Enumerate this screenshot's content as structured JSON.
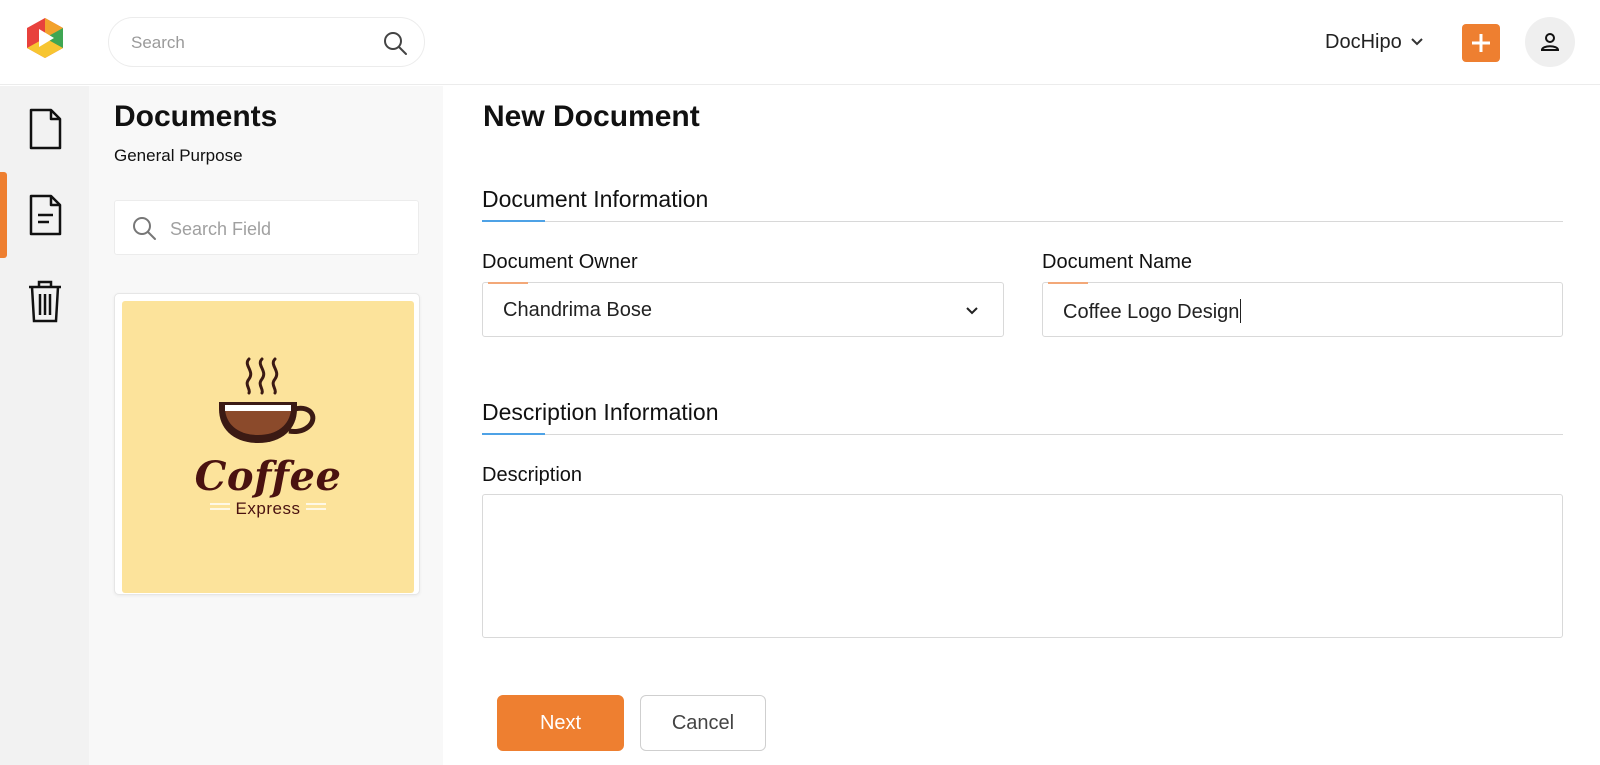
{
  "app": {
    "logo_icon": "dochipo-logo-icon"
  },
  "header": {
    "search": {
      "placeholder": "Search",
      "icon": "search-icon"
    },
    "account": {
      "name": "DocHipo",
      "icon": "chevron-down-icon"
    },
    "add_button": {
      "icon": "plus-icon",
      "color": "#ee7f30"
    },
    "avatar": {
      "icon": "user-icon"
    }
  },
  "rail": {
    "items": [
      {
        "name": "documents",
        "icon": "document-icon",
        "active": false
      },
      {
        "name": "templates",
        "icon": "document-lines-icon",
        "active": true
      },
      {
        "name": "trash",
        "icon": "trash-icon",
        "active": false
      }
    ],
    "accent_color": "#ee7f30"
  },
  "panel": {
    "title": "Documents",
    "subtitle": "General Purpose",
    "search": {
      "placeholder": "Search Field",
      "icon": "search-icon"
    },
    "template": {
      "icon": "coffee-cup-icon",
      "title": "Coffee",
      "subtitle": "Express",
      "background": "#fce39b"
    }
  },
  "main": {
    "title": "New Document",
    "sections": {
      "document_info": {
        "title": "Document Information"
      },
      "description_info": {
        "title": "Description Information"
      }
    },
    "fields": {
      "owner": {
        "label": "Document Owner",
        "value": "Chandrima Bose"
      },
      "name": {
        "label": "Document Name",
        "value": "Coffee Logo Design"
      },
      "description": {
        "label": "Description",
        "value": ""
      }
    },
    "buttons": {
      "next": "Next",
      "cancel": "Cancel"
    }
  }
}
